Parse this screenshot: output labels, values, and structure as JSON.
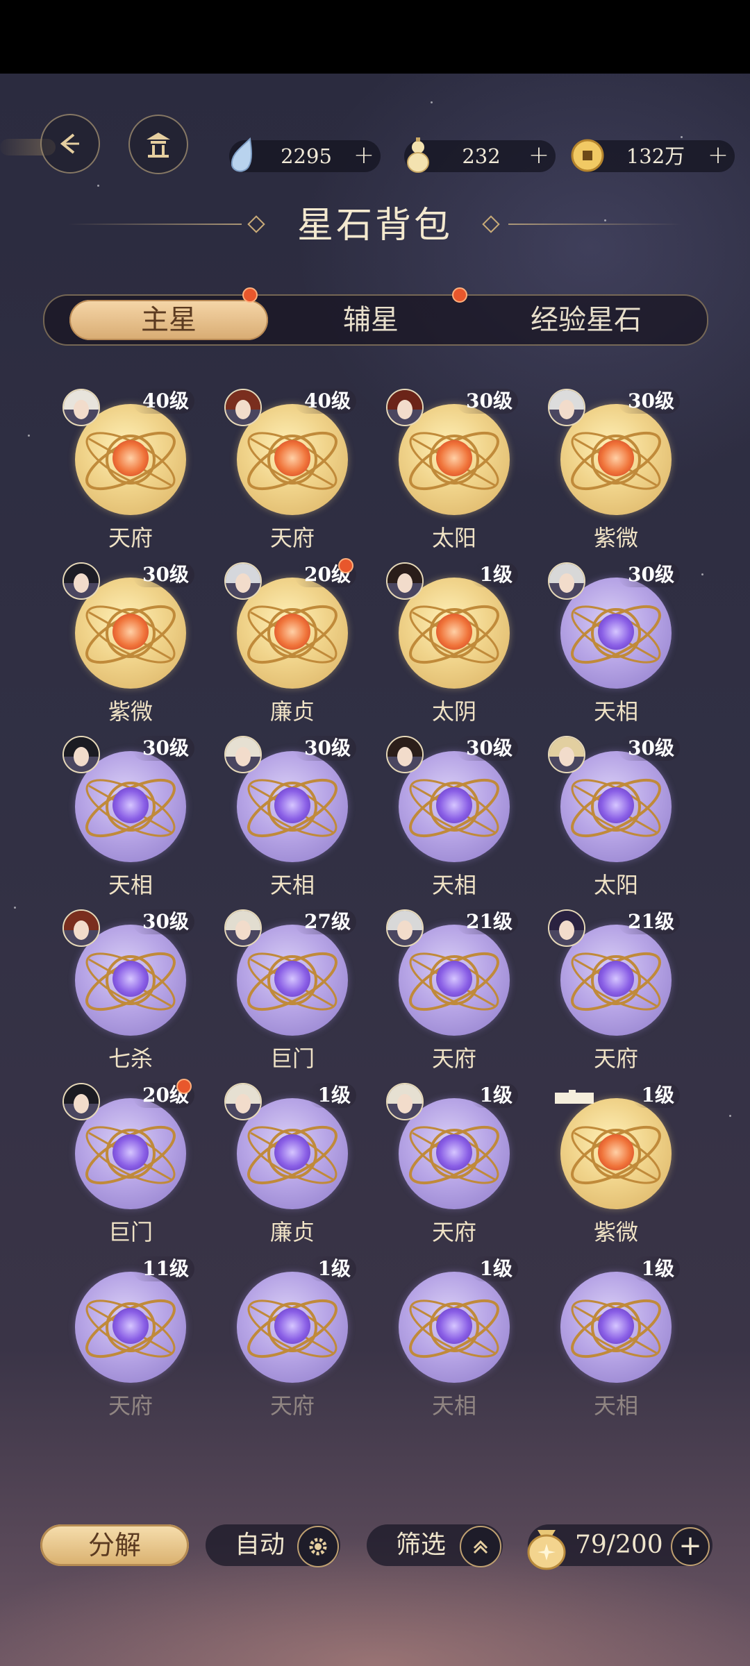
{
  "header": {
    "title": "星石背包",
    "resources": [
      {
        "name": "crystal-drop-icon",
        "value": "2295"
      },
      {
        "name": "gourd-icon",
        "value": "232"
      },
      {
        "name": "coin-icon",
        "value": "132万"
      }
    ]
  },
  "tabs": [
    {
      "label": "主星",
      "active": true,
      "badge": true
    },
    {
      "label": "辅星",
      "active": false,
      "badge": true
    },
    {
      "label": "经验星石",
      "active": false,
      "badge": false
    }
  ],
  "stones": [
    {
      "level": "40级",
      "name": "天府",
      "color": "gold",
      "hair": "#e8e4dc",
      "redDot": false
    },
    {
      "level": "40级",
      "name": "天府",
      "color": "gold",
      "hair": "#7a2e1e",
      "redDot": false
    },
    {
      "level": "30级",
      "name": "太阳",
      "color": "gold",
      "hair": "#6b2418",
      "redDot": false
    },
    {
      "level": "30级",
      "name": "紫微",
      "color": "gold",
      "hair": "#dcdcdc",
      "redDot": false
    },
    {
      "level": "30级",
      "name": "紫微",
      "color": "gold",
      "hair": "#1d1d26",
      "redDot": false
    },
    {
      "level": "20级",
      "name": "廉贞",
      "color": "gold",
      "hair": "#d5d7dc",
      "redDot": true
    },
    {
      "level": "1级",
      "name": "太阴",
      "color": "gold",
      "hair": "#2a1d1a",
      "redDot": false
    },
    {
      "level": "30级",
      "name": "天相",
      "color": "purple",
      "hair": "#d8d8d8",
      "redDot": false
    },
    {
      "level": "30级",
      "name": "天相",
      "color": "purple",
      "hair": "#1b1b22",
      "redDot": false
    },
    {
      "level": "30级",
      "name": "天相",
      "color": "purple",
      "hair": "#e6e0d2",
      "redDot": false
    },
    {
      "level": "30级",
      "name": "天相",
      "color": "purple",
      "hair": "#2b1e1a",
      "redDot": false
    },
    {
      "level": "30级",
      "name": "太阳",
      "color": "purple",
      "hair": "#e2cfa0",
      "redDot": false
    },
    {
      "level": "30级",
      "name": "七杀",
      "color": "purple",
      "hair": "#7a2e1e",
      "redDot": false
    },
    {
      "level": "27级",
      "name": "巨门",
      "color": "purple",
      "hair": "#e2ddd0",
      "redDot": false
    },
    {
      "level": "21级",
      "name": "天府",
      "color": "purple",
      "hair": "#d8d8d8",
      "redDot": false
    },
    {
      "level": "21级",
      "name": "天府",
      "color": "purple",
      "hair": "#2a2240",
      "redDot": false
    },
    {
      "level": "20级",
      "name": "巨门",
      "color": "purple",
      "hair": "#1b1b22",
      "redDot": true
    },
    {
      "level": "1级",
      "name": "廉贞",
      "color": "purple",
      "hair": "#e6e0d2",
      "redDot": false
    },
    {
      "level": "1级",
      "name": "天府",
      "color": "purple",
      "hair": "#e6e0d2",
      "redDot": false
    },
    {
      "level": "1级",
      "name": "紫微",
      "color": "gold",
      "hair": "",
      "redDot": false
    },
    {
      "level": "11级",
      "name": "天府",
      "color": "purple",
      "hair": "",
      "redDot": false
    },
    {
      "level": "1级",
      "name": "天府",
      "color": "purple",
      "hair": "",
      "redDot": false
    },
    {
      "level": "1级",
      "name": "天相",
      "color": "purple",
      "hair": "",
      "redDot": false
    },
    {
      "level": "1级",
      "name": "天相",
      "color": "purple",
      "hair": "",
      "redDot": false
    }
  ],
  "bottom": {
    "decompose_label": "分解",
    "auto_label": "自动",
    "filter_label": "筛选",
    "capacity": "79/200"
  }
}
